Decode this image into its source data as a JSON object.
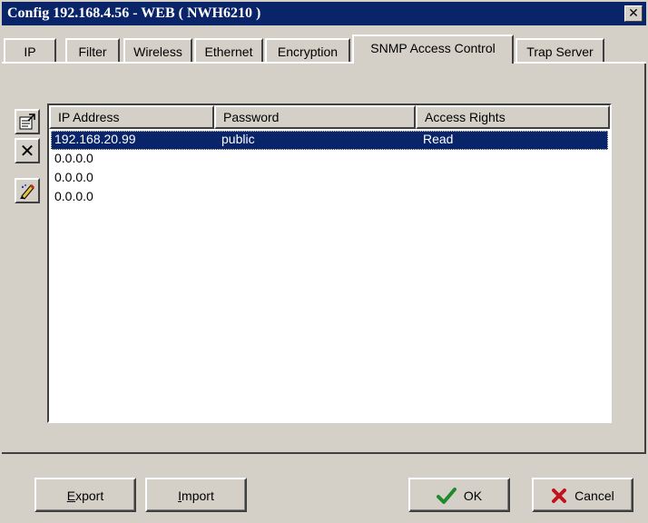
{
  "window": {
    "title": "Config 192.168.4.56 - WEB ( NWH6210 )",
    "close_glyph": "✕"
  },
  "tabs": [
    {
      "label": "IP"
    },
    {
      "label": "Filter"
    },
    {
      "label": "Wireless"
    },
    {
      "label": "Ethernet"
    },
    {
      "label": "Encryption"
    },
    {
      "label": "SNMP Access Control",
      "active": true
    },
    {
      "label": "Trap Server"
    }
  ],
  "toolbar": {
    "icons": [
      "properties-icon",
      "delete-icon",
      "edit-icon"
    ],
    "delete_glyph": "✕"
  },
  "table": {
    "columns": [
      "IP Address",
      "Password",
      "Access Rights"
    ],
    "rows": [
      {
        "ip": "192.168.20.99",
        "password": "public",
        "rights": "Read",
        "selected": true
      },
      {
        "ip": "0.0.0.0",
        "password": "",
        "rights": ""
      },
      {
        "ip": "0.0.0.0",
        "password": "",
        "rights": ""
      },
      {
        "ip": "0.0.0.0",
        "password": "",
        "rights": ""
      }
    ]
  },
  "buttons": {
    "export": {
      "mnemonic": "E",
      "rest": "xport"
    },
    "import": {
      "mnemonic": "I",
      "rest": "mport"
    },
    "ok": "OK",
    "cancel": "Cancel"
  },
  "colors": {
    "titlebar": "#0a246a",
    "selection": "#0a246a",
    "face": "#d4d0c8",
    "ok_check": "#1f8a2b",
    "cancel_x": "#c0121b"
  }
}
